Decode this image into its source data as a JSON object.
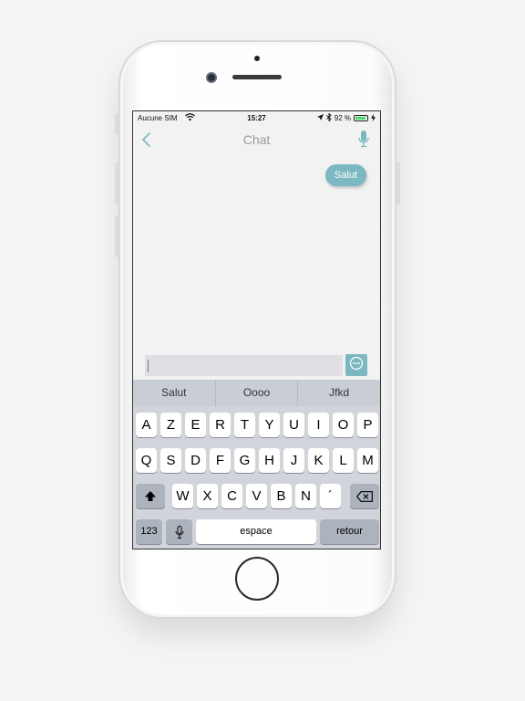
{
  "status_bar": {
    "carrier": "Aucune SIM",
    "time": "15:27",
    "battery": "92 %",
    "battery_level": 0.92,
    "battery_color": "#4cd964"
  },
  "navbar": {
    "title": "Chat",
    "back_icon": "chevron-left-icon",
    "mic_icon": "microphone-icon"
  },
  "messages": [
    {
      "text": "Salut",
      "sender": "user",
      "color": "#7bb8c1"
    }
  ],
  "input": {
    "value": "",
    "send_icon": "chat-bubble-icon"
  },
  "keyboard": {
    "suggestions": [
      "Salut",
      "Oooo",
      "Jfkd"
    ],
    "row1": [
      "A",
      "Z",
      "E",
      "R",
      "T",
      "Y",
      "U",
      "I",
      "O",
      "P"
    ],
    "row2": [
      "Q",
      "S",
      "D",
      "F",
      "G",
      "H",
      "J",
      "K",
      "L",
      "M"
    ],
    "row3": [
      "W",
      "X",
      "C",
      "V",
      "B",
      "N",
      "´"
    ],
    "shift_icon": "shift-icon",
    "delete_icon": "backspace-icon",
    "numbers_label": "123",
    "dictation_icon": "microphone-icon",
    "space_label": "espace",
    "return_label": "retour"
  }
}
